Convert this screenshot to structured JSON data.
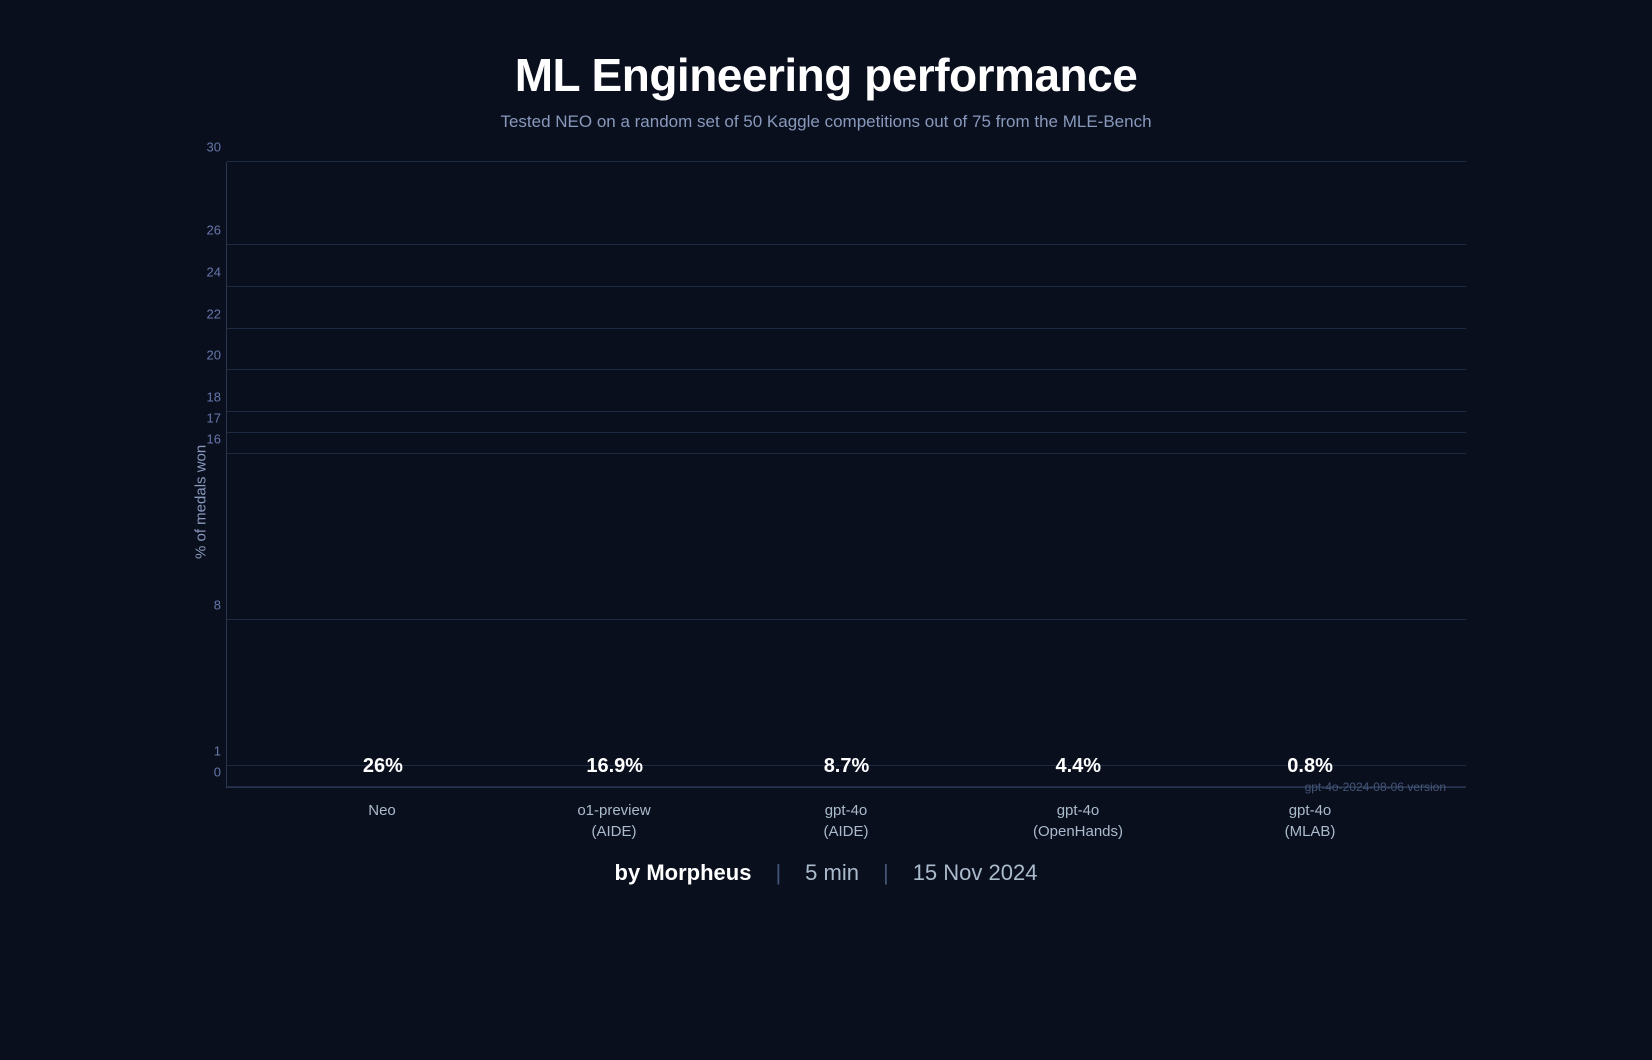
{
  "header": {
    "title": "ML Engineering performance",
    "subtitle": "Tested NEO on a random set of 50 Kaggle competitions out of 75 from the MLE-Bench"
  },
  "chart": {
    "y_axis_label": "% of medals won",
    "y_ticks": [
      {
        "label": "0",
        "pct": 0
      },
      {
        "label": "1",
        "pct": 3.33
      },
      {
        "label": "8",
        "pct": 26.67
      },
      {
        "label": "16",
        "pct": 53.33
      },
      {
        "label": "17",
        "pct": 56.67
      },
      {
        "label": "18",
        "pct": 60
      },
      {
        "label": "20",
        "pct": 66.67
      },
      {
        "label": "22",
        "pct": 73.33
      },
      {
        "label": "24",
        "pct": 80
      },
      {
        "label": "26",
        "pct": 86.67
      },
      {
        "label": "30",
        "pct": 100
      }
    ],
    "bars": [
      {
        "label": "Neo",
        "value": "26%",
        "pct": 86.67,
        "color": "blue",
        "x_label_line1": "Neo",
        "x_label_line2": ""
      },
      {
        "label": "o1-preview (AIDE)",
        "value": "16.9%",
        "pct": 56.33,
        "color": "yellow",
        "x_label_line1": "o1-preview",
        "x_label_line2": "(AIDE)"
      },
      {
        "label": "gpt-4o (AIDE)",
        "value": "8.7%",
        "pct": 29,
        "color": "yellow",
        "x_label_line1": "gpt-4o",
        "x_label_line2": "(AIDE)"
      },
      {
        "label": "gpt-4o (OpenHands)",
        "value": "4.4%",
        "pct": 14.67,
        "color": "yellow",
        "x_label_line1": "gpt-4o",
        "x_label_line2": "(OpenHands)"
      },
      {
        "label": "gpt-4o (MLAB)",
        "value": "0.8%",
        "pct": 2.67,
        "color": "yellow",
        "x_label_line1": "gpt-4o",
        "x_label_line2": "(MLAB)"
      }
    ],
    "version_note": "gpt-4o-2024-08-06 version"
  },
  "footer": {
    "by": "by Morpheus",
    "separator1": "|",
    "duration": "5 min",
    "separator2": "|",
    "date": "15 Nov 2024"
  }
}
